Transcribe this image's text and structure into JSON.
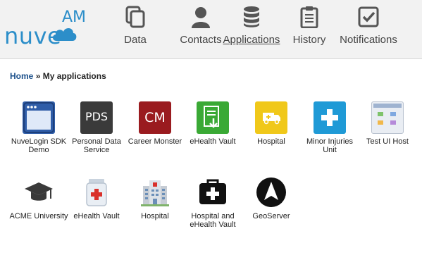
{
  "brand": {
    "text": "nuve",
    "suffix": "AM"
  },
  "nav": [
    {
      "id": "data",
      "label": "Data",
      "icon": "documents-icon"
    },
    {
      "id": "contacts",
      "label": "Contacts",
      "icon": "person-icon"
    },
    {
      "id": "applications",
      "label": "Applications",
      "icon": "database-icon",
      "active": true
    },
    {
      "id": "history",
      "label": "History",
      "icon": "clipboard-icon"
    },
    {
      "id": "notifications",
      "label": "Notifications",
      "icon": "checkbox-icon"
    }
  ],
  "breadcrumb": {
    "home": "Home",
    "separator": "»",
    "current": "My applications"
  },
  "apps": [
    {
      "label": "NuveLogin SDK Demo",
      "icon": "browser-window-icon"
    },
    {
      "label": "Personal Data Service",
      "icon": "pds-icon",
      "icon_text": "PDS"
    },
    {
      "label": "Career Monster",
      "icon": "career-monster-icon",
      "icon_text": "CM"
    },
    {
      "label": "eHealth Vault",
      "icon": "document-download-icon"
    },
    {
      "label": "Hospital",
      "icon": "ambulance-icon"
    },
    {
      "label": "Minor Injuries Unit",
      "icon": "medical-cross-icon"
    },
    {
      "label": "Test UI Host",
      "icon": "window-grid-icon"
    },
    {
      "label": "ACME University",
      "icon": "graduation-cap-icon"
    },
    {
      "label": "eHealth Vault",
      "icon": "medicine-jar-icon"
    },
    {
      "label": "Hospital",
      "icon": "hospital-building-icon"
    },
    {
      "label": "Hospital and eHealth Vault",
      "icon": "first-aid-kit-icon"
    },
    {
      "label": "GeoServer",
      "icon": "navigation-arrow-icon"
    }
  ],
  "colors": {
    "link": "#1a4f8a",
    "brand": "#2c8ec9",
    "nav_icon": "#555555"
  }
}
